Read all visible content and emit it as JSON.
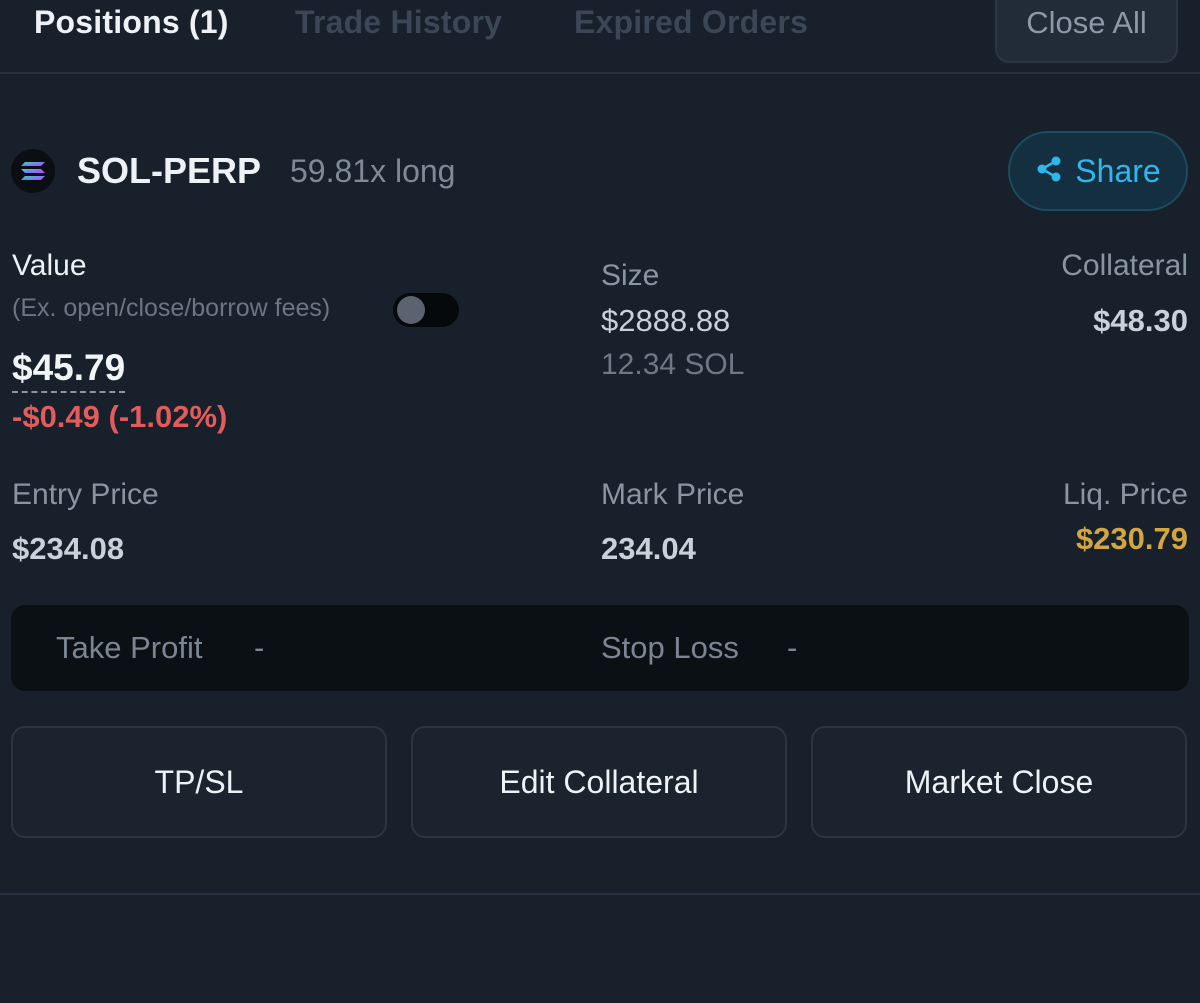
{
  "tabs": {
    "positions": "Positions (1)",
    "trade_history": "Trade History",
    "expired_orders": "Expired Orders",
    "close_all": "Close All"
  },
  "position": {
    "market": "SOL-PERP",
    "leverage": "59.81x long",
    "share_label": "Share",
    "value_label": "Value",
    "fees_note": "(Ex. open/close/borrow fees)",
    "fees_toggle_on": false,
    "value": "$45.79",
    "pnl": "-$0.49 (-1.02%)",
    "size_label": "Size",
    "size_usd": "$2888.88",
    "size_token": "12.34 SOL",
    "collateral_label": "Collateral",
    "collateral": "$48.30",
    "entry_price_label": "Entry Price",
    "entry_price": "$234.08",
    "mark_price_label": "Mark Price",
    "mark_price": "234.04",
    "liq_price_label": "Liq. Price",
    "liq_price": "$230.79",
    "take_profit_label": "Take Profit",
    "take_profit": "-",
    "stop_loss_label": "Stop Loss",
    "stop_loss": "-"
  },
  "actions": {
    "tpsl": "TP/SL",
    "edit_collateral": "Edit Collateral",
    "market_close": "Market Close"
  },
  "colors": {
    "background": "#17202b",
    "accent": "#2fb6ec",
    "negative": "#e25c5c",
    "liquidation": "#d2a640"
  },
  "icons": {
    "market": "solana-logo-icon",
    "share": "share-icon"
  }
}
